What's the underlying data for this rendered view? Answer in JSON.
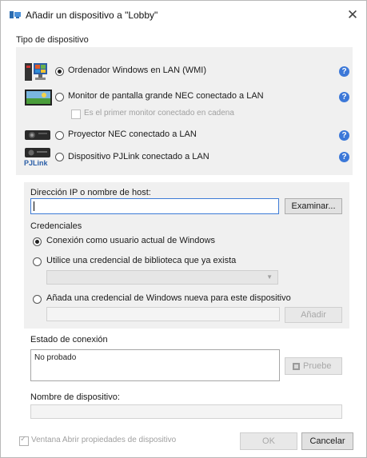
{
  "window": {
    "title": "Añadir un dispositivo a \"Lobby\"",
    "close": "✕"
  },
  "device_type": {
    "label": "Tipo de dispositivo",
    "options": [
      {
        "label": "Ordenador Windows en LAN (WMI)",
        "checked": true
      },
      {
        "label": "Monitor de pantalla grande NEC conectado a LAN",
        "checked": false
      },
      {
        "label": "Proyector NEC conectado a LAN",
        "checked": false
      },
      {
        "label": "Dispositivo PJLink conectado a LAN",
        "checked": false
      }
    ],
    "sub_checkbox": "Es el primer monitor conectado en cadena",
    "help": "?",
    "pjlink_text": "PJLink"
  },
  "host": {
    "label": "Dirección IP o nombre de host:",
    "value": "",
    "browse": "Examinar..."
  },
  "credentials": {
    "label": "Credenciales",
    "options": [
      {
        "label": "Conexión como usuario actual de Windows",
        "checked": true
      },
      {
        "label": "Utilice una credencial de biblioteca que ya exista",
        "checked": false
      },
      {
        "label": "Añada una credencial de Windows nueva para este dispositivo",
        "checked": false
      }
    ],
    "add_button": "Añadir"
  },
  "connection": {
    "label": "Estado de conexión",
    "status": "No probado",
    "test_button": "Pruebe"
  },
  "device_name": {
    "label": "Nombre de dispositivo:",
    "value": ""
  },
  "footer": {
    "open_props": "Ventana Abrir propiedades de dispositivo",
    "ok": "OK",
    "cancel": "Cancelar"
  }
}
